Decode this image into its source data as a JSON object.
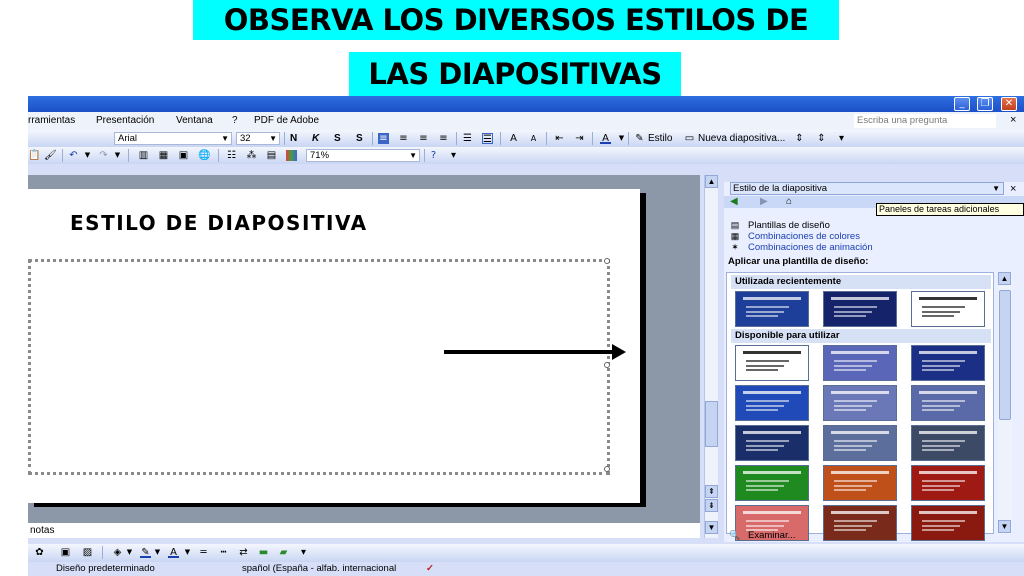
{
  "heading": {
    "line1": "OBSERVA LOS DIVERSOS ESTILOS DE",
    "line2": "LAS DIAPOSITIVAS",
    "band_color": "#00ffff"
  },
  "window": {
    "buttons": {
      "minimize": "_",
      "restore": "❐",
      "close": "✕"
    }
  },
  "menubar": {
    "items": [
      "rramientas",
      "Presentación",
      "Ventana",
      "?",
      "PDF de Adobe"
    ],
    "ask_placeholder": "Escriba una pregunta",
    "close_glyph": "×"
  },
  "format_toolbar": {
    "font": "Arial",
    "size": "32",
    "bold": "N",
    "italic": "K",
    "underline": "S",
    "shadow": "S",
    "style_label": "Estilo",
    "new_slide_label": "Nueva diapositiva..."
  },
  "standard_toolbar": {
    "zoom": "71%"
  },
  "slide": {
    "title": "ESTILO DE DIAPOSITIVA"
  },
  "notes": {
    "label": "notas"
  },
  "statusbar": {
    "design": "Diseño predeterminado",
    "language": "spañol (España - alfab. internacional"
  },
  "taskpane": {
    "title": "Estilo de la diapositiva",
    "tooltip": "Paneles de tareas adicionales",
    "links": [
      {
        "label": "Plantillas de diseño",
        "icon": "design-templates-icon"
      },
      {
        "label": "Combinaciones de colores",
        "icon": "color-schemes-icon"
      },
      {
        "label": "Combinaciones de animación",
        "icon": "animation-schemes-icon"
      }
    ],
    "apply_label": "Aplicar una plantilla de diseño:",
    "recent_label": "Utilizada recientemente",
    "available_label": "Disponible para utilizar",
    "browse_label": "Examinar...",
    "recent_thumbs": [
      "#1d3f9a",
      "#15236a",
      "#ffffff"
    ],
    "available_thumbs": [
      "#ffffff",
      "#5a66b8",
      "#1c2f86",
      "#1f4ab8",
      "#6b78b8",
      "#5a6aa8",
      "#1a2e6a",
      "#5c6f9c",
      "#3c4a66",
      "#1f8a1f",
      "#c0501a",
      "#a01a14",
      "#d96a6a",
      "#7a2a1a",
      "#8a1a10"
    ]
  }
}
